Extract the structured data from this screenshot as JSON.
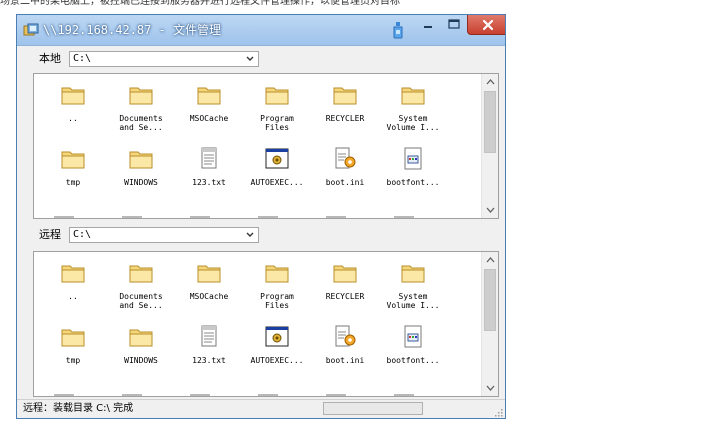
{
  "caption": "场景二中的某电脑上，被控端已连接到服务器并进行远程文件管理操作，以便管理员对目标机器进行远程运维操作",
  "window": {
    "title": "\\\\192.168.42.87 - 文件管理"
  },
  "local": {
    "label": "本地",
    "path": "C:\\"
  },
  "remote": {
    "label": "远程",
    "path": "C:\\"
  },
  "local_files": [
    {
      "name": "..",
      "icon": "folder-icon"
    },
    {
      "name": "Documents\nand Se...",
      "icon": "folder-icon"
    },
    {
      "name": "MSOCache",
      "icon": "folder-icon"
    },
    {
      "name": "Program\nFiles",
      "icon": "folder-icon"
    },
    {
      "name": "RECYCLER",
      "icon": "folder-icon"
    },
    {
      "name": "System\nVolume I...",
      "icon": "folder-icon"
    },
    {
      "name": "tmp",
      "icon": "folder-icon"
    },
    {
      "name": "WINDOWS",
      "icon": "folder-icon"
    },
    {
      "name": "123.txt",
      "icon": "text-file-icon"
    },
    {
      "name": "AUTOEXEC...",
      "icon": "batch-file-icon"
    },
    {
      "name": "boot.ini",
      "icon": "settings-file-icon"
    },
    {
      "name": "bootfont...",
      "icon": "system-file-icon"
    }
  ],
  "remote_files": [
    {
      "name": "..",
      "icon": "folder-icon"
    },
    {
      "name": "Documents\nand Se...",
      "icon": "folder-icon"
    },
    {
      "name": "MSOCache",
      "icon": "folder-icon"
    },
    {
      "name": "Program\nFiles",
      "icon": "folder-icon"
    },
    {
      "name": "RECYCLER",
      "icon": "folder-icon"
    },
    {
      "name": "System\nVolume I...",
      "icon": "folder-icon"
    },
    {
      "name": "tmp",
      "icon": "folder-icon"
    },
    {
      "name": "WINDOWS",
      "icon": "folder-icon"
    },
    {
      "name": "123.txt",
      "icon": "text-file-icon"
    },
    {
      "name": "AUTOEXEC...",
      "icon": "batch-file-icon"
    },
    {
      "name": "boot.ini",
      "icon": "settings-file-icon"
    },
    {
      "name": "bootfont...",
      "icon": "system-file-icon"
    }
  ],
  "status": {
    "text": "远程：装载目录 C:\\ 完成"
  },
  "colors": {
    "title_bar": "#9fc3eb",
    "close_button": "#c7402f",
    "folder": "#f5d67a"
  }
}
